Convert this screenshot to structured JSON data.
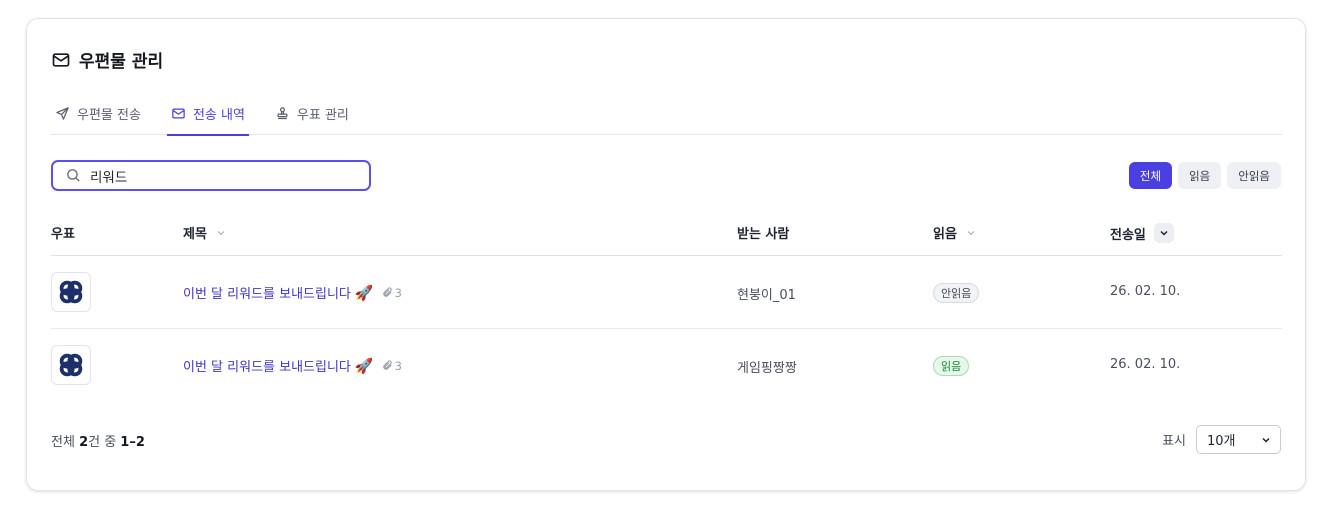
{
  "header": {
    "title": "우편물 관리",
    "icon": "mail-icon"
  },
  "tabs": [
    {
      "label": "우편물 전송",
      "icon": "send-icon",
      "active": false
    },
    {
      "label": "전송 내역",
      "icon": "mail-icon",
      "active": true
    },
    {
      "label": "우표 관리",
      "icon": "stamp-icon",
      "active": false
    }
  ],
  "search": {
    "value": "리워드",
    "placeholder": ""
  },
  "filters": [
    {
      "label": "전체",
      "active": true
    },
    {
      "label": "읽음",
      "active": false
    },
    {
      "label": "안읽음",
      "active": false
    }
  ],
  "table": {
    "headers": {
      "stamp": "우표",
      "subject": "제목",
      "recipient": "받는 사람",
      "read": "읽음",
      "sent": "전송일"
    },
    "rows": [
      {
        "subject": "이번 달 리워드를 보내드립니다",
        "emoji": "🚀",
        "attachments": "3",
        "recipient": "현붕이_01",
        "status": "안읽음",
        "date": "26. 02. 10."
      },
      {
        "subject": "이번 달 리워드를 보내드립니다",
        "emoji": "🚀",
        "attachments": "3",
        "recipient": "게임핑짱짱",
        "status": "읽음",
        "date": "26. 02. 10."
      }
    ]
  },
  "footer": {
    "prefix": "전체 ",
    "total": "2",
    "mid": "건 중 ",
    "range": "1–2",
    "page_size_label": "표시",
    "page_size_value": "10개"
  },
  "colors": {
    "accent": "#4a3fe0",
    "link": "#3d35c9",
    "read_badge": "#1c8a3a",
    "stamp_logo": "#1d2f6b"
  }
}
